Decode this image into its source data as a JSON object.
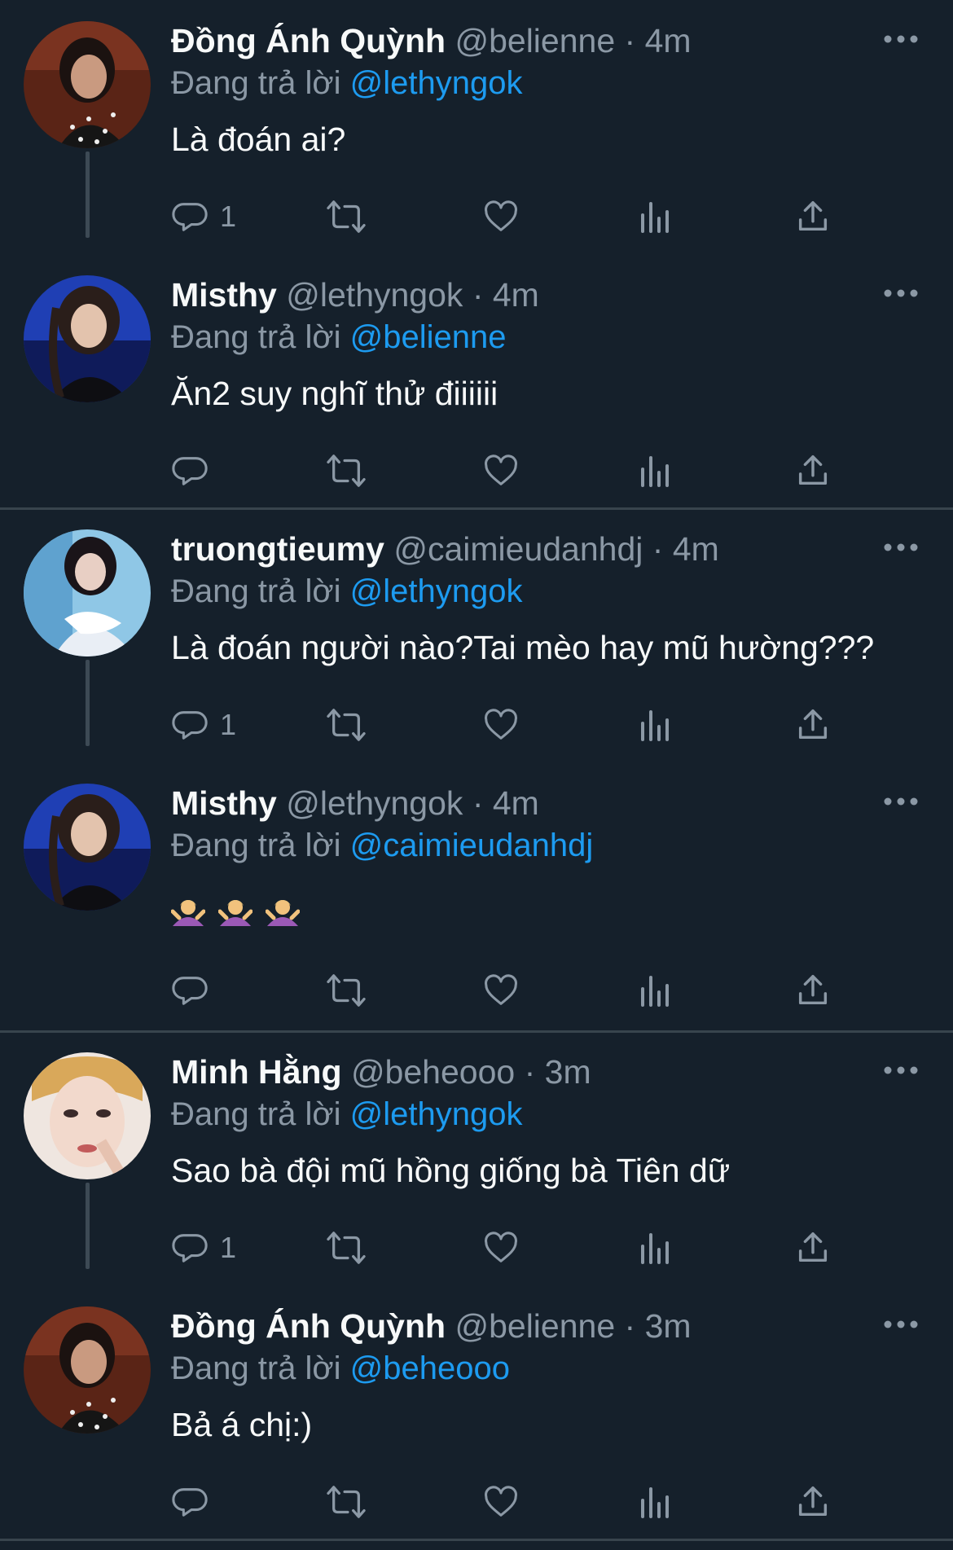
{
  "reply_prefix": "Đang trả lời",
  "tweets": [
    {
      "name": "Đồng Ánh Quỳnh",
      "handle": "@belienne",
      "sep": "·",
      "time": "4m",
      "reply_to": "@lethyngok",
      "text": "Là đoán ai?",
      "reply_count": "1"
    },
    {
      "name": "Misthy",
      "handle": "@lethyngok",
      "sep": "·",
      "time": "4m",
      "reply_to": "@belienne",
      "text": "Ăn2 suy nghĩ thử điiiiii",
      "reply_count": ""
    },
    {
      "name": "truongtieumy",
      "handle": "@caimieudanhdj",
      "sep": "·",
      "time": "4m",
      "reply_to": "@lethyngok",
      "text": "Là đoán người nào?Tai mèo hay mũ hường???",
      "reply_count": "1"
    },
    {
      "name": "Misthy",
      "handle": "@lethyngok",
      "sep": "·",
      "time": "4m",
      "reply_to": "@caimieudanhdj",
      "emoji": [
        "person-shrugging-emoji",
        "person-shrugging-emoji",
        "person-shrugging-emoji"
      ],
      "reply_count": ""
    },
    {
      "name": "Minh Hằng",
      "handle": "@beheooo",
      "sep": "·",
      "time": "3m",
      "reply_to": "@lethyngok",
      "text": "Sao bà đội mũ hồng giống bà Tiên dữ",
      "reply_count": "1"
    },
    {
      "name": "Đồng Ánh Quỳnh",
      "handle": "@belienne",
      "sep": "·",
      "time": "3m",
      "reply_to": "@beheooo",
      "text": "Bả á chị:)",
      "reply_count": ""
    }
  ],
  "icons": {
    "reply": "speech-bubble-icon",
    "retweet": "retweet-icon",
    "like": "heart-icon",
    "views": "bar-chart-icon",
    "share": "share-upload-icon",
    "more": "more-dots-icon"
  },
  "colors": {
    "background": "#15202b",
    "link": "#1d9bf0",
    "muted": "#8b98a5",
    "divider": "#38444d"
  }
}
